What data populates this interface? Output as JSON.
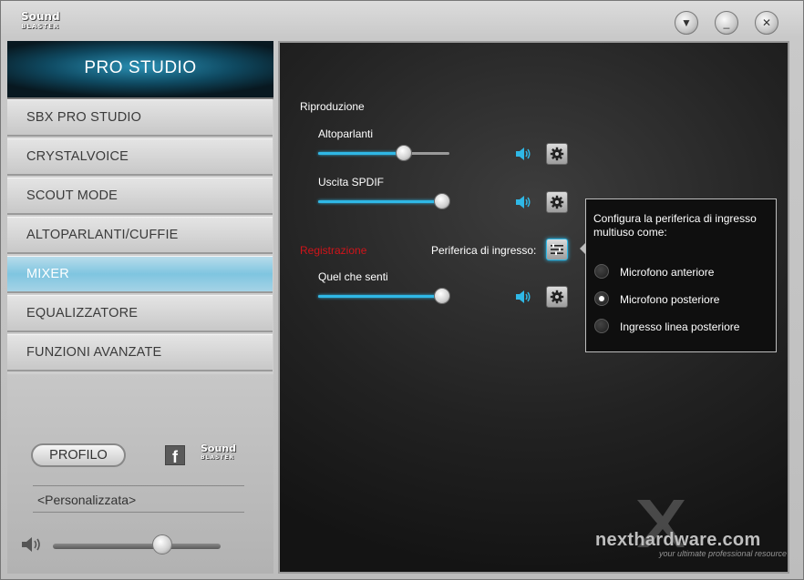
{
  "app": {
    "logo_line1": "Sound",
    "logo_line2": "BLASTER"
  },
  "window_buttons": [
    {
      "name": "menu",
      "glyph": "▼"
    },
    {
      "name": "minimize",
      "glyph": "_"
    },
    {
      "name": "close",
      "glyph": "✕"
    }
  ],
  "sidebar": {
    "brand": "PRO STUDIO",
    "items": [
      {
        "label": "SBX PRO STUDIO",
        "active": false
      },
      {
        "label": "CRYSTALVOICE",
        "active": false
      },
      {
        "label": "SCOUT MODE",
        "active": false
      },
      {
        "label": "ALTOPARLANTI/CUFFIE",
        "active": false
      },
      {
        "label": "MIXER",
        "active": true
      },
      {
        "label": "EQUALIZZATORE",
        "active": false
      },
      {
        "label": "FUNZIONI AVANZATE",
        "active": false
      }
    ],
    "profile_button": "PROFILO",
    "profile_value": "<Personalizzata>",
    "facebook_glyph": "f",
    "sb_logo_line1": "Sound",
    "sb_logo_line2": "BLASTER",
    "master_volume": 0.66
  },
  "main": {
    "playback_header": "Riproduzione",
    "recording_header": "Registrazione",
    "input_device_label": "Periferica di ingresso:",
    "channels": [
      {
        "label": "Altoparlanti",
        "level": 0.65
      },
      {
        "label": "Uscita SPDIF",
        "level": 0.95
      },
      {
        "label": "Quel che senti",
        "level": 0.95
      }
    ]
  },
  "popup": {
    "title": "Configura la periferica di ingresso multiuso come:",
    "options": [
      {
        "label": "Microfono anteriore",
        "selected": false
      },
      {
        "label": "Microfono posteriore",
        "selected": true
      },
      {
        "label": "Ingresso linea posteriore",
        "selected": false
      }
    ]
  },
  "watermark": {
    "name": "nexthardware.com",
    "tagline": "your ultimate professional resource"
  },
  "colors": {
    "accent": "#2fb8e6",
    "recording_red": "#d0141a"
  }
}
